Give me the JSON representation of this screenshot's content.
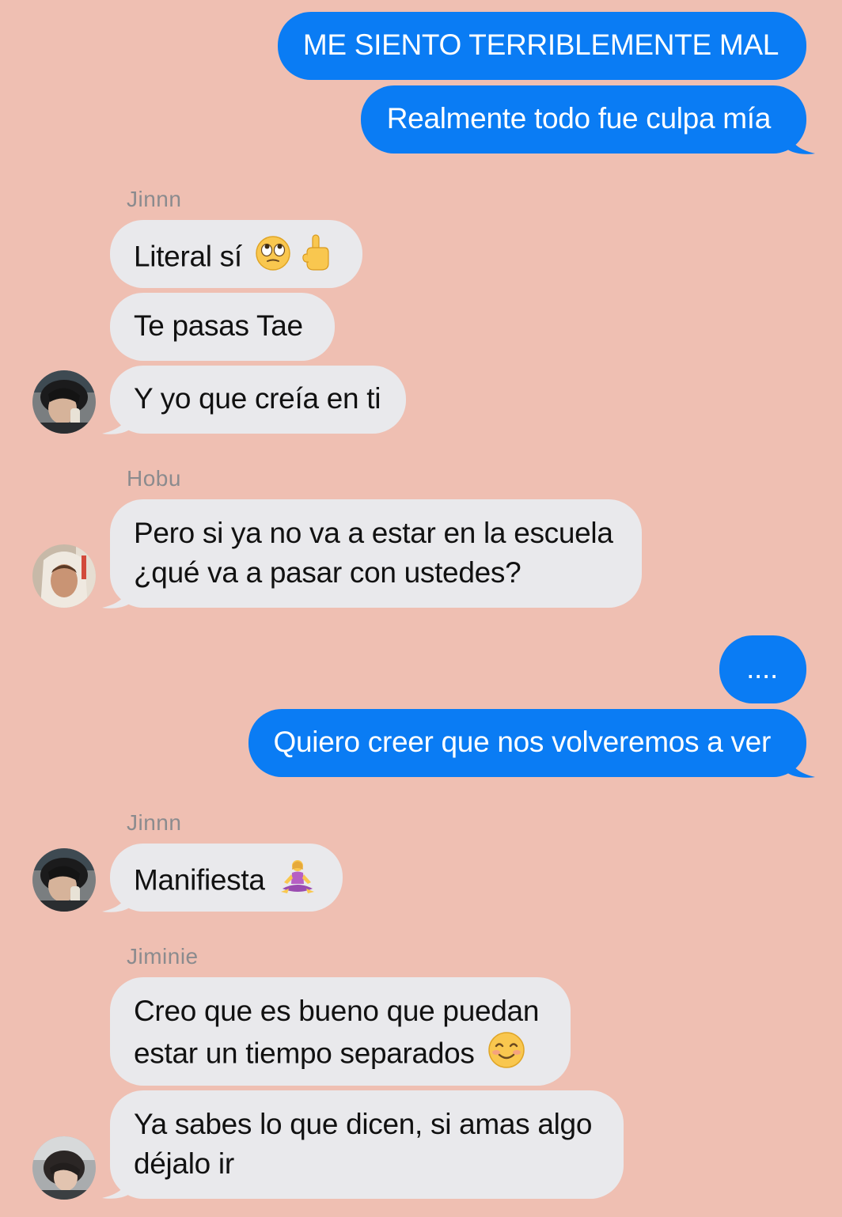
{
  "colors": {
    "background": "#EFBFB2",
    "outgoing_bubble": "#0A7CF4",
    "incoming_bubble": "#E9E9EC",
    "sender_name": "#8B8B8E"
  },
  "messages": {
    "m1": "ME SIENTO TERRIBLEMENTE MAL",
    "m2": "Realmente todo fue culpa mía",
    "sender_jinnn_1": "Jinnn",
    "m3_text": "Literal sí",
    "m3_emojis": [
      "face-with-rolling-eyes-icon",
      "pointing-up-icon"
    ],
    "m4": "Te pasas Tae",
    "m5": "Y yo que creía en ti",
    "sender_hobu": "Hobu",
    "m6_line1": "Pero si ya no va a estar en la escuela",
    "m6_line2": "¿qué va a pasar con ustedes?",
    "m7": "....",
    "m8": "Quiero creer que nos volveremos a ver",
    "sender_jinnn_2": "Jinnn",
    "m9_text": "Manifiesta",
    "m9_emoji": "person-in-lotus-position-icon",
    "sender_jiminie": "Jiminie",
    "m10_line1": "Creo que es bueno que puedan",
    "m10_line2_text": "estar un tiempo separados",
    "m10_emoji": "smiling-face-icon",
    "m11_line1": "Ya sabes lo que dicen, si amas algo",
    "m11_line2": "déjalo ir"
  }
}
